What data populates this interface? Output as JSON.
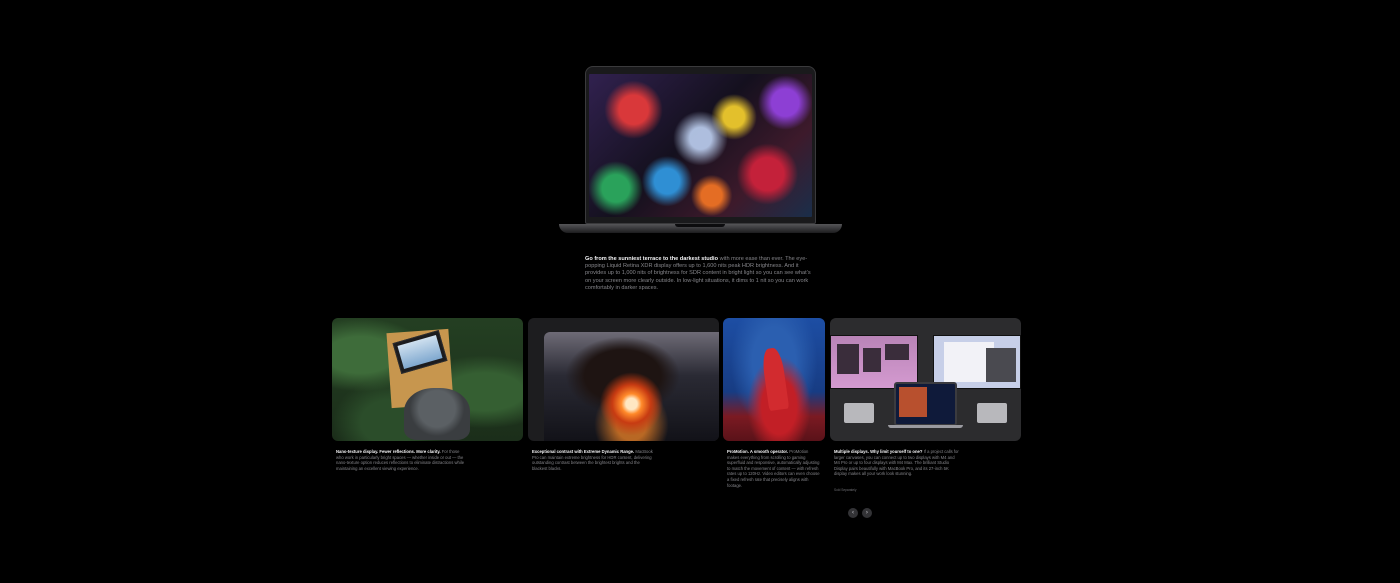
{
  "hero": {
    "lead": "Go from the sunniest terrace to the darkest studio",
    "body": " with more ease than ever. The eye-popping Liquid Retina XDR display offers up to 1,600 nits peak HDR brightness. And it provides up to 1,000 nits of brightness for SDR content in bright light so you can see what’s on your screen more clearly outside. In low-light situations, it dims to 1 nit so you can work comfortably in darker spaces."
  },
  "cards": [
    {
      "title": "Nano-texture display. Fewer reflections. More clarity.",
      "body": " For those who work in particularly bright spaces — whether inside or out — the nano-texture option reduces reflections to eliminate distractions while maintaining an excellent viewing experience."
    },
    {
      "title": "Exceptional contrast with Extreme Dynamic Range.",
      "body": " MacBook Pro can maintain extreme brightness for HDR content, delivering outstanding contrast between the brightest brights and the blackest blacks."
    },
    {
      "title": "ProMotion. A smooth operator.",
      "body": " ProMotion makes everything from scrolling to gaming superfluid and responsive, automatically adjusting to match the movement of content — with refresh rates up to 120Hz. Video editors can even choose a fixed refresh rate that precisely aligns with footage."
    },
    {
      "title": "Multiple displays. Why limit yourself to one?",
      "body": " If a project calls for larger canvases, you can connect up to two displays with M4 and M4 Pro or up to four displays with M4 Max. The brilliant Studio Display pairs beautifully with MacBook Pro, and its 27-inch 5K display makes all your work look stunning.",
      "note": "Sold Separately"
    }
  ],
  "nav": {
    "prev_icon": "‹",
    "next_icon": "›"
  }
}
